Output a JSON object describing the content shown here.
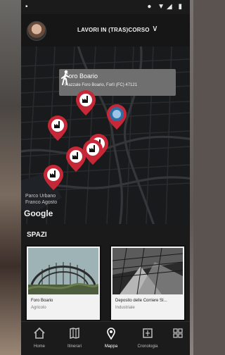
{
  "status_bar": {
    "left_glyph": "▪",
    "right_glyphs": "● ▼◢ ▮"
  },
  "header": {
    "title": "LAVORI IN (TRAS)CORSO",
    "chevron": "∨"
  },
  "map": {
    "popup": {
      "title": "Foro Boario",
      "subtitle": "Piazzale Foro Boario, Forlì (FC) 47121"
    },
    "labels": {
      "park_line1": "Parco Urbano",
      "park_line2": "Franco Agosto"
    },
    "google_logo": "Google"
  },
  "spazi": {
    "title": "SPAZI",
    "cards": [
      {
        "name": "Foro Boario",
        "category": "Agricolo"
      },
      {
        "name": "Deposito delle Corriere SI...",
        "category": "Industriale"
      }
    ]
  },
  "bottom_nav": {
    "items": [
      {
        "label": "Home"
      },
      {
        "label": "Itinerari"
      },
      {
        "label": "Mappa"
      },
      {
        "label": "Cronologia"
      },
      {
        "label": ""
      }
    ]
  },
  "colors": {
    "pin": "#c62837",
    "pin_selected": "#2f6ea5",
    "map_bg": "#191a1c"
  }
}
